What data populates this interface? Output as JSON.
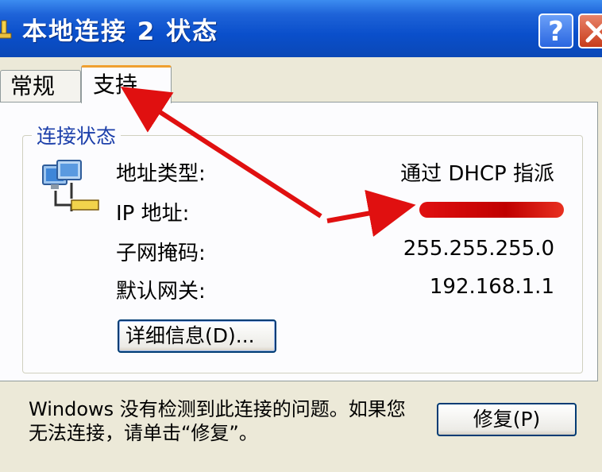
{
  "window": {
    "title": "本地连接 2 状态",
    "help_label": "?"
  },
  "tabs": [
    {
      "label": "常规",
      "selected": false
    },
    {
      "label": "支持",
      "selected": true
    }
  ],
  "connection_status": {
    "group_label": "连接状态",
    "rows": [
      {
        "label": "地址类型:",
        "value": "通过 DHCP 指派"
      },
      {
        "label": "IP 地址:",
        "value": ""
      },
      {
        "label": "子网掩码:",
        "value": "255.255.255.0"
      },
      {
        "label": "默认网关:",
        "value": "192.168.1.1"
      }
    ],
    "details_button": "详细信息(D)..."
  },
  "footer": {
    "message": "Windows 没有检测到此连接的问题。如果您无法连接，请单击“修复”。",
    "repair_button": "修复(P)"
  },
  "colors": {
    "titlebar": "#0A4FCB",
    "dialog_bg": "#ECE9D8",
    "annotation_arrow": "#E01010",
    "group_label": "#1C3FAA"
  }
}
